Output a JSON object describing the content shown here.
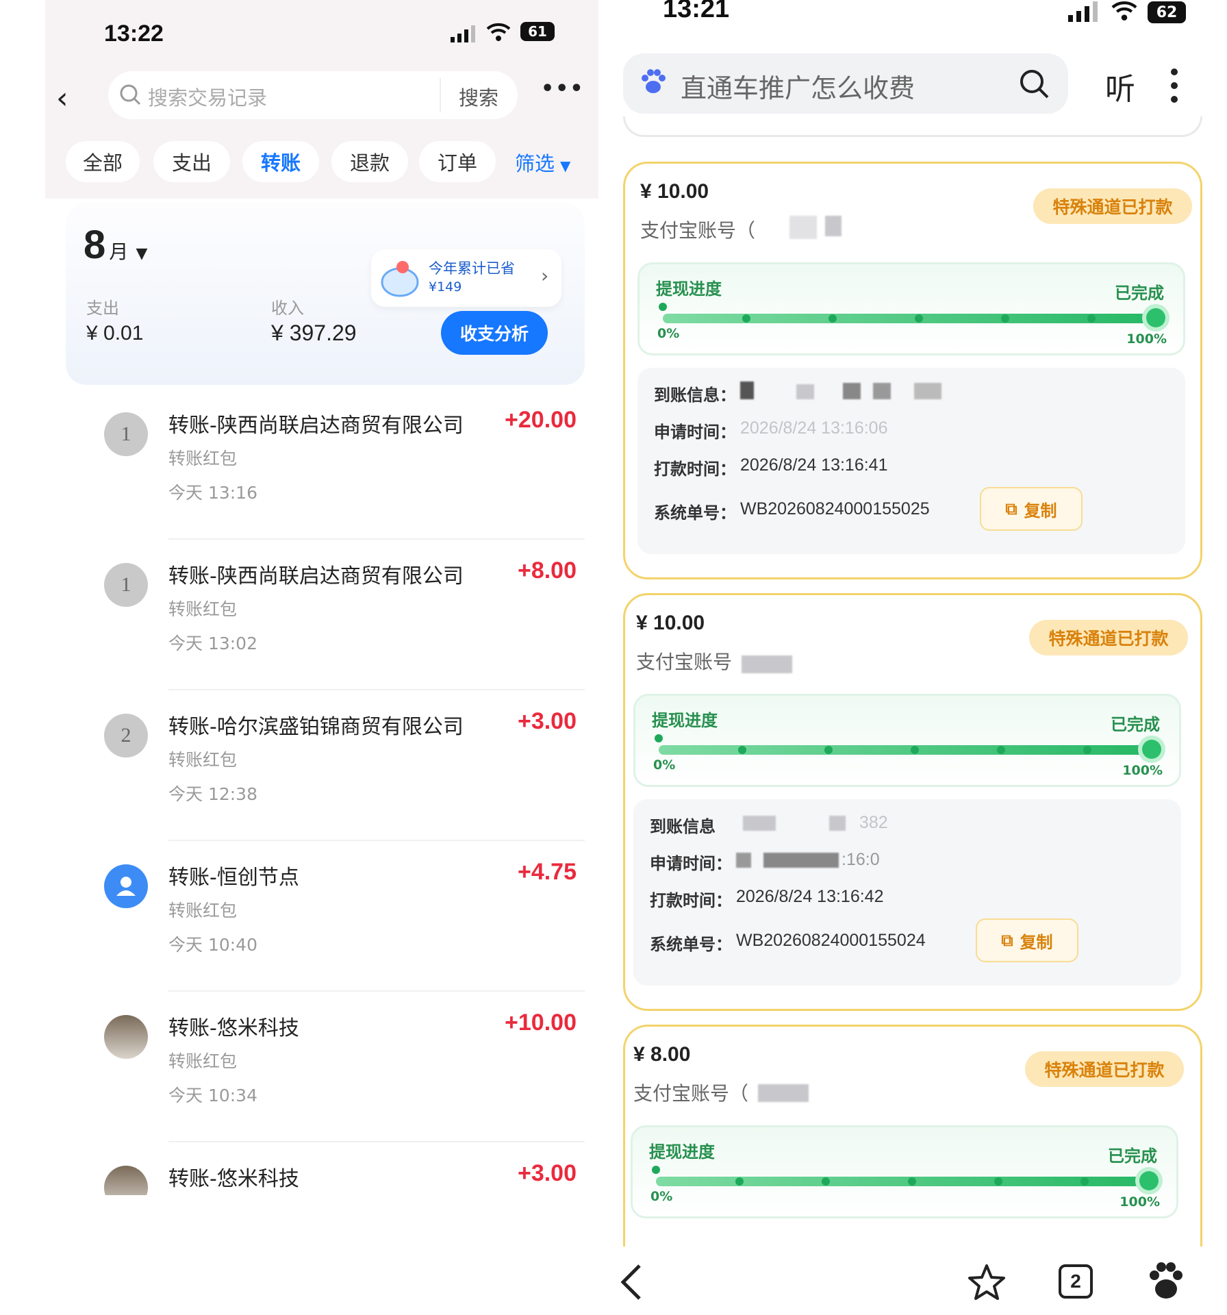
{
  "left": {
    "status_time": "13:22",
    "battery": "61",
    "search_placeholder": "搜索交易记录",
    "search_button": "搜索",
    "more": "•••",
    "tabs": [
      "全部",
      "支出",
      "转账",
      "退款",
      "订单"
    ],
    "filter": "筛选",
    "month_num": "8",
    "month_unit": "月",
    "savings_title": "今年累计已省",
    "savings_value": "¥149",
    "expense_label": "支出",
    "expense_value": "¥ 0.01",
    "income_label": "收入",
    "income_value": "¥ 397.29",
    "analysis_button": "收支分析",
    "transactions": [
      {
        "title": "转账-陕西尚联启达商贸有限公司",
        "sub": "转账红包",
        "time": "今天 13:16",
        "amount": "+20.00",
        "avatar": "1"
      },
      {
        "title": "转账-陕西尚联启达商贸有限公司",
        "sub": "转账红包",
        "time": "今天 13:02",
        "amount": "+8.00",
        "avatar": "1"
      },
      {
        "title": "转账-哈尔滨盛铂锦商贸有限公司",
        "sub": "转账红包",
        "time": "今天 12:38",
        "amount": "+3.00",
        "avatar": "2"
      },
      {
        "title": "转账-恒创节点",
        "sub": "转账红包",
        "time": "今天 10:40",
        "amount": "+4.75",
        "avatar": ""
      },
      {
        "title": "转账-悠米科技",
        "sub": "转账红包",
        "time": "今天 10:34",
        "amount": "+10.00",
        "avatar": ""
      },
      {
        "title": "转账-悠米科技",
        "sub": "",
        "time": "",
        "amount": "+3.00",
        "avatar": ""
      }
    ]
  },
  "right": {
    "status_time": "13:21",
    "battery": "62",
    "search_text": "直通车推广怎么收费",
    "listen": "听",
    "cards": [
      {
        "amount": "¥ 10.00",
        "account_label": "支付宝账号（",
        "badge": "特殊通道已打款",
        "progress_title": "提现进度",
        "progress_done": "已完成",
        "progress_fraction": 1.0,
        "p0": "0%",
        "p100": "100%",
        "arrival_label": "到账信息：",
        "apply_label": "申请时间：",
        "apply_value": "2026/8/24 13:16:06",
        "pay_label": "打款时间：",
        "pay_value": "2026/8/24 13:16:41",
        "order_label": "系统单号：",
        "order_value": "WB20260824000155025",
        "copy": "复制"
      },
      {
        "amount": "¥ 10.00",
        "account_label": "支付宝账号",
        "badge": "特殊通道已打款",
        "progress_title": "提现进度",
        "progress_done": "已完成",
        "progress_fraction": 1.0,
        "p0": "0%",
        "p100": "100%",
        "arrival_label": "到账信息",
        "apply_label": "申请时间：",
        "apply_value": ":16:0",
        "pay_label": "打款时间：",
        "pay_value": "2026/8/24 13:16:42",
        "order_label": "系统单号：",
        "order_value": "WB20260824000155024",
        "copy": "复制",
        "arrival_partial": "382"
      },
      {
        "amount": "¥ 8.00",
        "account_label": "支付宝账号（",
        "badge": "特殊通道已打款",
        "progress_title": "提现进度",
        "progress_done": "已完成",
        "progress_fraction": 1.0,
        "p0": "0%",
        "p100": "100%"
      }
    ],
    "tab_count": "2"
  }
}
